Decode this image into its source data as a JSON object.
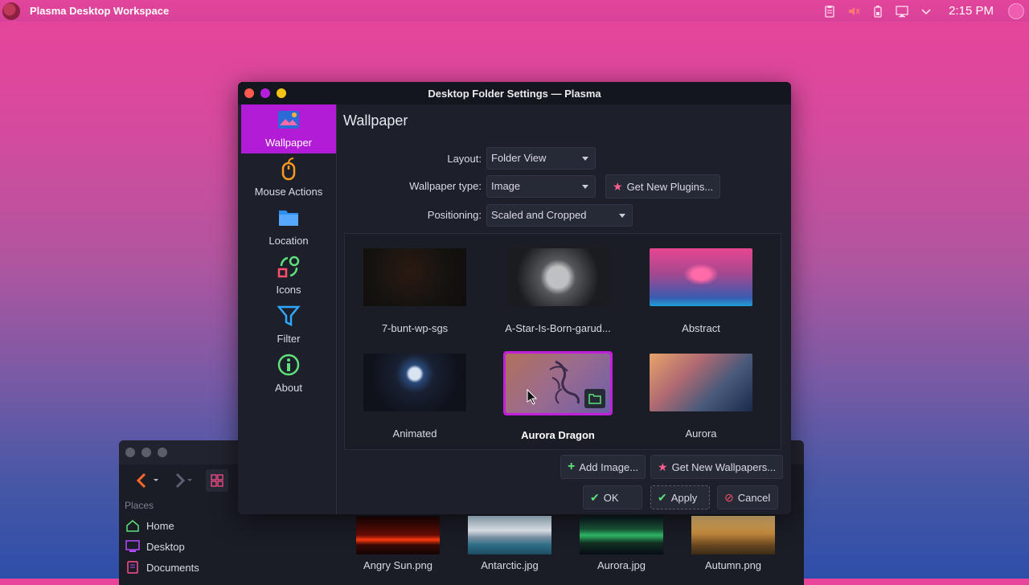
{
  "topbar": {
    "title": "Plasma Desktop Workspace",
    "clock": "2:15 PM",
    "tray_icons": [
      "clipboard-icon",
      "volume-muted-icon",
      "battery-icon",
      "network-icon",
      "chevron-down-icon"
    ]
  },
  "dialog": {
    "title": "Desktop Folder Settings — Plasma",
    "sidebar": [
      {
        "label": "Wallpaper",
        "icon": "wallpaper-icon",
        "active": true
      },
      {
        "label": "Mouse Actions",
        "icon": "mouse-icon"
      },
      {
        "label": "Location",
        "icon": "folder-icon"
      },
      {
        "label": "Icons",
        "icon": "icons-icon"
      },
      {
        "label": "Filter",
        "icon": "filter-icon"
      },
      {
        "label": "About",
        "icon": "info-icon"
      }
    ],
    "page_title": "Wallpaper",
    "form": {
      "layout_label": "Layout:",
      "layout_value": "Folder View",
      "type_label": "Wallpaper type:",
      "type_value": "Image",
      "plugins_button": "Get New Plugins...",
      "positioning_label": "Positioning:",
      "positioning_value": "Scaled and Cropped"
    },
    "wallpapers": [
      {
        "name": "7-bunt-wp-sgs"
      },
      {
        "name": "A-Star-Is-Born-garud..."
      },
      {
        "name": "Abstract"
      },
      {
        "name": "Animated"
      },
      {
        "name": "Aurora Dragon",
        "selected": true
      },
      {
        "name": "Aurora"
      }
    ],
    "add_image_button": "Add Image...",
    "get_wallpapers_button": "Get New Wallpapers...",
    "ok_button": "OK",
    "apply_button": "Apply",
    "cancel_button": "Cancel"
  },
  "file_manager": {
    "places_label": "Places",
    "places": [
      {
        "label": "Home"
      },
      {
        "label": "Desktop"
      },
      {
        "label": "Documents"
      }
    ],
    "files": [
      {
        "name": "Angry Sun.png"
      },
      {
        "name": "Antarctic.jpg"
      },
      {
        "name": "Aurora.jpg"
      },
      {
        "name": "Autumn.png"
      }
    ]
  },
  "colors": {
    "accent": "#b31cd6",
    "panel": "#e2459a",
    "dialog_bg": "#1d202b"
  }
}
